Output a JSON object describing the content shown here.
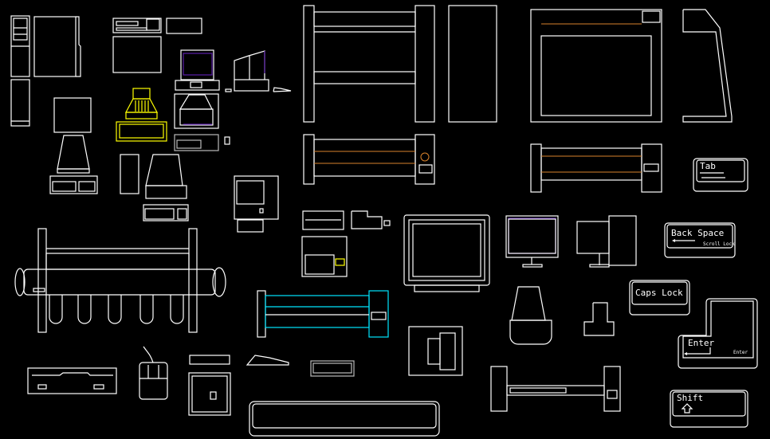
{
  "drawing": {
    "background": "#000000",
    "colors": {
      "line": "#ffffff",
      "highlight": "#ffff00",
      "accent": "#00e5ff",
      "screen": "#5a1fa8",
      "plotter_strip": "#d9822b"
    },
    "keys": {
      "tab": "Tab",
      "backspace": "Back Space",
      "scroll_lock": "Scroll Lock",
      "caps_lock": "Caps Lock",
      "enter": "Enter",
      "enter_small": "Enter",
      "shift": "Shift"
    }
  }
}
